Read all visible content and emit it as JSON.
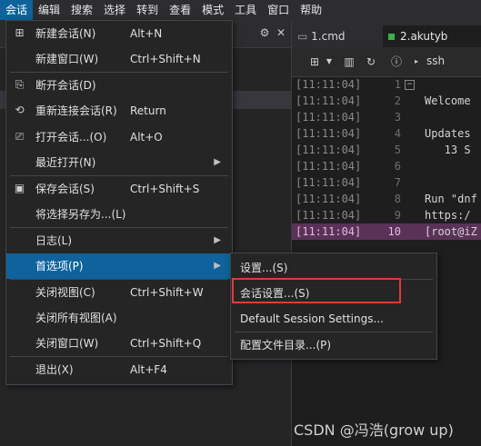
{
  "menubar": [
    "会话",
    "编辑",
    "搜索",
    "选择",
    "转到",
    "查看",
    "模式",
    "工具",
    "窗口",
    "帮助"
  ],
  "tabs": {
    "tab1": "1.cmd",
    "tab2": "2.akutyb"
  },
  "toolbar": {
    "ssh_label": "ssh"
  },
  "terminal": {
    "timestamp": "[11:11:04]",
    "lines": [
      {
        "n": "1",
        "t": ""
      },
      {
        "n": "2",
        "t": "Welcome"
      },
      {
        "n": "3",
        "t": ""
      },
      {
        "n": "4",
        "t": "Updates"
      },
      {
        "n": "5",
        "t": "   13 S"
      },
      {
        "n": "6",
        "t": ""
      },
      {
        "n": "7",
        "t": ""
      },
      {
        "n": "8",
        "t": "Run \"dnf"
      },
      {
        "n": "9",
        "t": "https:/"
      },
      {
        "n": "10",
        "t": "[root@iZ"
      }
    ]
  },
  "session_menu": {
    "items": [
      {
        "label": "新建会话(N)",
        "shortcut": "Alt+N"
      },
      {
        "label": "新建窗口(W)",
        "shortcut": "Ctrl+Shift+N"
      },
      {
        "label": "断开会话(D)",
        "shortcut": ""
      },
      {
        "label": "重新连接会话(R)",
        "shortcut": "Return"
      },
      {
        "label": "打开会话...(O)",
        "shortcut": "Alt+O"
      },
      {
        "label": "最近打开(N)",
        "shortcut": ""
      },
      {
        "label": "保存会话(S)",
        "shortcut": "Ctrl+Shift+S"
      },
      {
        "label": "将选择另存为...(L)",
        "shortcut": ""
      },
      {
        "label": "日志(L)",
        "shortcut": ""
      },
      {
        "label": "首选项(P)",
        "shortcut": ""
      },
      {
        "label": "关闭视图(C)",
        "shortcut": "Ctrl+Shift+W"
      },
      {
        "label": "关闭所有视图(A)",
        "shortcut": ""
      },
      {
        "label": "关闭窗口(W)",
        "shortcut": "Ctrl+Shift+Q"
      },
      {
        "label": "退出(X)",
        "shortcut": "Alt+F4"
      }
    ]
  },
  "preferences_submenu": {
    "items": [
      "设置...(S)",
      "会话设置...(S)",
      "Default Session Settings...",
      "配置文件目录...(P)"
    ]
  },
  "watermark": "CSDN @冯浩(grow up)",
  "colors": {
    "accent": "#0e639c",
    "highlight_box": "#e53935",
    "active_line": "#5a3258"
  }
}
